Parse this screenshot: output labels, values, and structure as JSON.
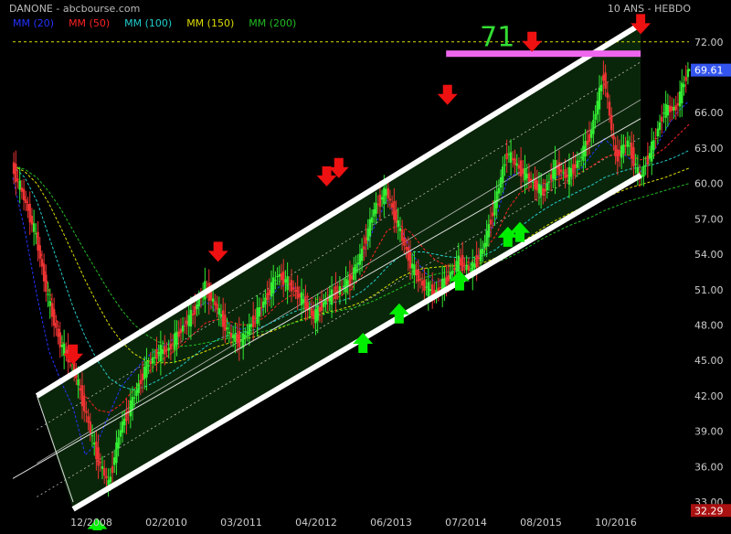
{
  "header": {
    "symbol_source": "DANONE - abcbourse.com",
    "period_label": "10 ANS - HEBDO"
  },
  "chart_data": {
    "type": "candlestick",
    "series": [
      {
        "name": "MM (20)",
        "color": "#2233ff",
        "values": [
          60.5,
          56.0,
          50.5,
          45.8,
          43.2,
          41.0,
          37.0,
          38.0,
          40.5,
          42.8,
          44.0,
          45.2,
          46.0,
          46.5,
          47.8,
          49.2,
          50.0,
          49.0,
          48.0,
          47.6,
          48.2,
          49.8,
          51.2,
          51.5,
          50.5,
          49.4,
          50.2,
          50.8,
          51.8,
          53.8,
          56.5,
          58.6,
          56.6,
          54.2,
          52.6,
          51.6,
          52.0,
          52.8,
          53.2,
          54.6,
          57.0,
          60.5,
          61.0,
          60.2,
          59.8,
          60.5,
          61.0,
          61.2,
          62.5,
          63.8,
          62.8,
          62.2,
          61.0,
          62.5,
          64.5,
          66.0,
          67.0
        ]
      },
      {
        "name": "MM (50)",
        "color": "#ff2222",
        "values": [
          61.0,
          59.0,
          55.5,
          51.0,
          47.0,
          44.0,
          42.0,
          40.8,
          40.6,
          41.3,
          42.5,
          43.8,
          44.8,
          45.5,
          46.3,
          47.3,
          48.2,
          48.5,
          48.3,
          48.0,
          48.1,
          48.8,
          49.8,
          50.5,
          50.6,
          50.2,
          50.1,
          50.4,
          51.0,
          52.3,
          54.2,
          56.0,
          56.5,
          55.8,
          54.5,
          53.5,
          53.0,
          53.1,
          53.4,
          54.2,
          55.6,
          57.8,
          59.2,
          59.8,
          60.0,
          60.3,
          60.6,
          60.9,
          61.5,
          62.2,
          62.5,
          62.4,
          62.0,
          62.3,
          63.0,
          64.0,
          65.0
        ]
      },
      {
        "name": "MM (100)",
        "color": "#22cccc",
        "values": [
          61.5,
          60.5,
          58.5,
          55.5,
          52.5,
          49.5,
          47.0,
          45.0,
          43.5,
          42.8,
          42.5,
          42.8,
          43.3,
          43.9,
          44.6,
          45.4,
          46.2,
          46.8,
          47.2,
          47.4,
          47.6,
          48.0,
          48.5,
          49.0,
          49.4,
          49.6,
          49.8,
          50.0,
          50.3,
          50.9,
          51.8,
          52.9,
          53.8,
          54.2,
          54.2,
          54.0,
          53.8,
          53.7,
          53.7,
          53.9,
          54.4,
          55.3,
          56.3,
          57.1,
          57.8,
          58.4,
          58.9,
          59.4,
          59.9,
          60.5,
          60.9,
          61.2,
          61.4,
          61.6,
          61.9,
          62.3,
          62.8
        ]
      },
      {
        "name": "MM (150)",
        "color": "#dddd00",
        "values": [
          61.5,
          61.0,
          60.0,
          58.3,
          56.2,
          54.0,
          51.8,
          49.8,
          48.0,
          46.6,
          45.6,
          45.0,
          44.8,
          44.8,
          45.0,
          45.4,
          45.8,
          46.2,
          46.5,
          46.8,
          47.0,
          47.3,
          47.7,
          48.1,
          48.5,
          48.8,
          49.1,
          49.3,
          49.6,
          50.0,
          50.6,
          51.3,
          52.0,
          52.5,
          52.8,
          52.9,
          53.0,
          53.0,
          53.1,
          53.3,
          53.7,
          54.2,
          54.9,
          55.6,
          56.3,
          56.9,
          57.4,
          57.9,
          58.3,
          58.8,
          59.2,
          59.6,
          59.9,
          60.2,
          60.5,
          60.9,
          61.3
        ]
      },
      {
        "name": "MM (200)",
        "color": "#22bb22",
        "values": [
          61.5,
          61.2,
          60.5,
          59.3,
          57.8,
          56.0,
          54.2,
          52.5,
          50.8,
          49.3,
          48.1,
          47.2,
          46.6,
          46.3,
          46.2,
          46.3,
          46.5,
          46.7,
          46.9,
          47.1,
          47.3,
          47.5,
          47.8,
          48.1,
          48.4,
          48.7,
          49.0,
          49.2,
          49.4,
          49.7,
          50.1,
          50.6,
          51.1,
          51.6,
          52.0,
          52.3,
          52.5,
          52.6,
          52.8,
          53.0,
          53.3,
          53.7,
          54.2,
          54.8,
          55.4,
          55.9,
          56.4,
          56.8,
          57.2,
          57.7,
          58.1,
          58.5,
          58.8,
          59.1,
          59.4,
          59.7,
          60.0
        ]
      }
    ],
    "price": {
      "values": [
        61.5,
        58.8,
        55.5,
        50.2,
        46.4,
        44.8,
        41.0,
        37.0,
        34.5,
        39.2,
        41.6,
        44.2,
        45.6,
        46.0,
        47.6,
        49.0,
        51.2,
        49.4,
        47.2,
        46.6,
        48.4,
        50.2,
        52.3,
        51.4,
        50.2,
        48.7,
        50.1,
        50.9,
        51.8,
        54.2,
        57.8,
        59.4,
        56.4,
        53.2,
        51.4,
        50.7,
        51.8,
        53.4,
        52.6,
        54.4,
        58.3,
        62.6,
        61.3,
        60.2,
        59.2,
        61.4,
        60.6,
        62.0,
        64.4,
        69.3,
        62.2,
        63.5,
        60.4,
        63.0,
        66.2,
        66.4,
        69.61
      ]
    },
    "x_tick_labels": [
      "12/2008",
      "02/2010",
      "03/2011",
      "04/2012",
      "06/2013",
      "07/2014",
      "08/2015",
      "10/2016"
    ],
    "y_tick_labels": [
      "33.00",
      "36.00",
      "39.00",
      "42.00",
      "45.00",
      "48.00",
      "51.00",
      "54.00",
      "57.00",
      "60.00",
      "63.00",
      "66.00",
      "72.00"
    ],
    "ylim": [
      32.0,
      74.0
    ],
    "annotations": {
      "resistance_value": "71",
      "resistance_level": 71.0,
      "last_price_label": "69.61",
      "last_price": 69.61,
      "lowest_label": "32.29",
      "lowest": 32.29,
      "reference_level_label": "72.00",
      "reference_level": 72.0,
      "down_arrows": [
        [
          5,
          44.5
        ],
        [
          17,
          53.2
        ],
        [
          26,
          59.6
        ],
        [
          27,
          60.3
        ],
        [
          36,
          66.5
        ],
        [
          43,
          71.0
        ],
        [
          52,
          72.5
        ]
      ],
      "up_arrows": [
        [
          7,
          31.8
        ],
        [
          29,
          47.5
        ],
        [
          32,
          50.0
        ],
        [
          37,
          52.8
        ],
        [
          41,
          56.5
        ],
        [
          42,
          56.9
        ]
      ],
      "channel_upper": [
        [
          2,
          42.0
        ],
        [
          52,
          73.5
        ]
      ],
      "channel_lower": [
        [
          5,
          32.4
        ],
        [
          52,
          60.7
        ]
      ]
    },
    "grid": false,
    "legend_position": "top-left",
    "colors": {
      "background": "#000000",
      "candle_up": "#33ee33",
      "candle_down": "#ee3333",
      "channel": "#ffffff",
      "resistance": "#ee66ee",
      "arrow_down": "#ee1111",
      "arrow_up": "#00ee00",
      "price_badge": "#3355ee",
      "low_badge": "#aa1111",
      "annotation_text": "#33dd33"
    }
  }
}
